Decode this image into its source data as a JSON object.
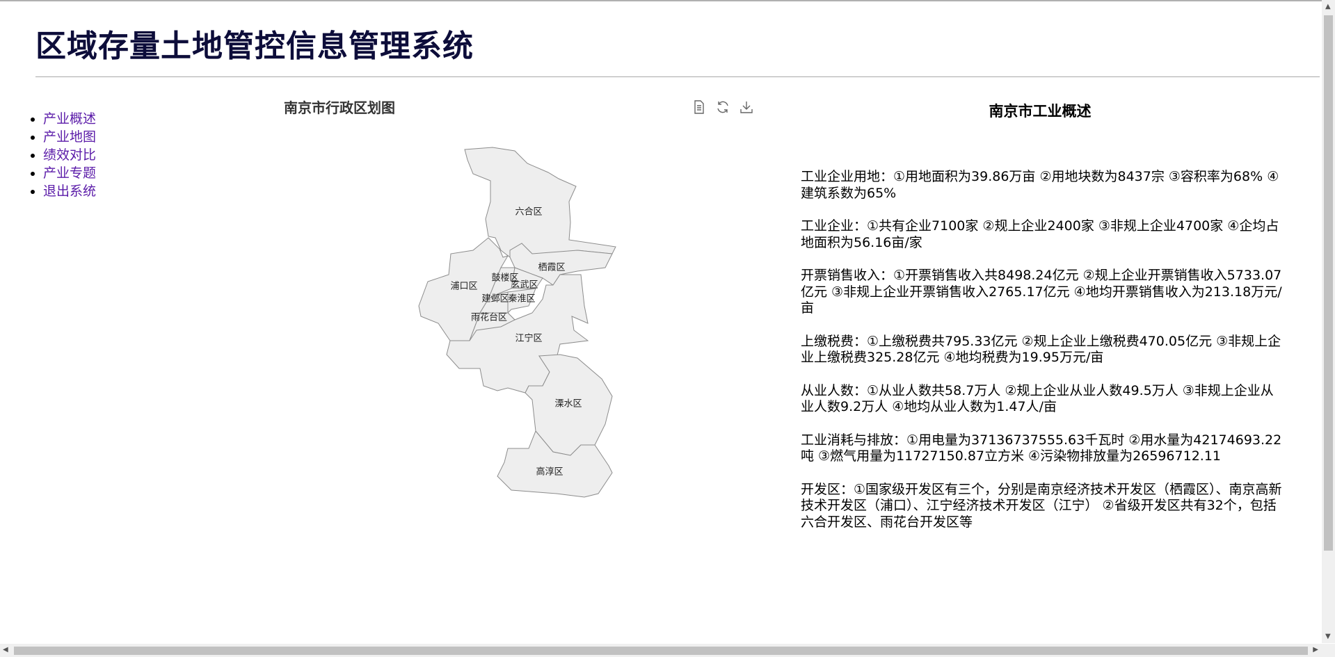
{
  "header": {
    "title": "区域存量土地管控信息管理系统"
  },
  "nav": {
    "items": [
      {
        "label": "产业概述"
      },
      {
        "label": "产业地图"
      },
      {
        "label": "绩效对比"
      },
      {
        "label": "产业专题"
      },
      {
        "label": "退出系统"
      }
    ]
  },
  "map": {
    "title": "南京市行政区划图",
    "toolbox": [
      "data-view-icon",
      "restore-icon",
      "save-image-icon"
    ],
    "fill_color": "#eeeeee",
    "districts": {
      "liuhe": "六合区",
      "qixia": "栖霞区",
      "gulou": "鼓楼区",
      "pukou": "浦口区",
      "xuanwu": "玄武区",
      "jianye": "建邺区",
      "qinhuai": "秦淮区",
      "yuhuatai": "雨花台区",
      "jiangning": "江宁区",
      "lishui": "溧水区",
      "gaochun": "高淳区"
    }
  },
  "overview": {
    "title": "南京市工业概述",
    "paragraphs": [
      "工业企业用地：①用地面积为39.86万亩 ②用地块数为8437宗 ③容积率为68% ④建筑系数为65%",
      "工业企业：①共有企业7100家 ②规上企业2400家 ③非规上企业4700家 ④企均占地面积为56.16亩/家",
      "开票销售收入：①开票销售收入共8498.24亿元 ②规上企业开票销售收入5733.07亿元 ③非规上企业开票销售收入2765.17亿元 ④地均开票销售收入为213.18万元/亩",
      "上缴税费：①上缴税费共795.33亿元 ②规上企业上缴税费470.05亿元 ③非规上企业上缴税费325.28亿元 ④地均税费为19.95万元/亩",
      "从业人数：①从业人数共58.7万人 ②规上企业从业人数49.5万人 ③非规上企业从业人数9.2万人 ④地均从业人数为1.47人/亩",
      "工业消耗与排放：①用电量为37136737555.63千瓦时 ②用水量为42174693.22吨 ③燃气用量为11727150.87立方米 ④污染物排放量为26596712.11",
      "开发区：①国家级开发区有三个，分别是南京经济技术开发区（栖霞区）、南京高新技术开发区（浦口）、江宁经济技术开发区（江宁） ②省级开发区共有32个，包括六合开发区、雨花台开发区等"
    ]
  }
}
